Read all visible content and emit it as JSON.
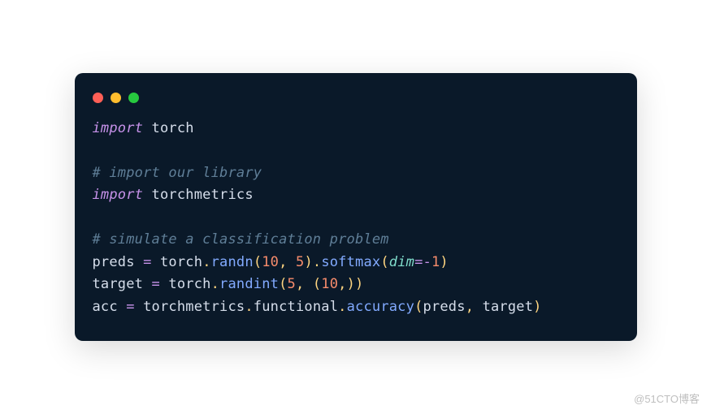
{
  "watermark": "@51CTO博客",
  "code": {
    "lines": [
      {
        "t": [
          {
            "c": "tok-keyword",
            "v": "import"
          },
          {
            "c": "",
            "v": " "
          },
          {
            "c": "tok-module",
            "v": "torch"
          }
        ]
      },
      {
        "t": []
      },
      {
        "t": [
          {
            "c": "tok-comment",
            "v": "# import our library"
          }
        ]
      },
      {
        "t": [
          {
            "c": "tok-keyword",
            "v": "import"
          },
          {
            "c": "",
            "v": " "
          },
          {
            "c": "tok-module",
            "v": "torchmetrics"
          }
        ]
      },
      {
        "t": []
      },
      {
        "t": [
          {
            "c": "tok-comment",
            "v": "# simulate a classification problem"
          }
        ]
      },
      {
        "t": [
          {
            "c": "tok-ident",
            "v": "preds"
          },
          {
            "c": "",
            "v": " "
          },
          {
            "c": "tok-op",
            "v": "="
          },
          {
            "c": "",
            "v": " "
          },
          {
            "c": "tok-ident",
            "v": "torch"
          },
          {
            "c": "tok-punct",
            "v": "."
          },
          {
            "c": "tok-func",
            "v": "randn"
          },
          {
            "c": "tok-punct",
            "v": "("
          },
          {
            "c": "tok-num",
            "v": "10"
          },
          {
            "c": "tok-punct",
            "v": ","
          },
          {
            "c": "",
            "v": " "
          },
          {
            "c": "tok-num",
            "v": "5"
          },
          {
            "c": "tok-punct",
            "v": ")."
          },
          {
            "c": "tok-func",
            "v": "softmax"
          },
          {
            "c": "tok-punct",
            "v": "("
          },
          {
            "c": "tok-param",
            "v": "dim"
          },
          {
            "c": "tok-op",
            "v": "=-"
          },
          {
            "c": "tok-num",
            "v": "1"
          },
          {
            "c": "tok-punct",
            "v": ")"
          }
        ]
      },
      {
        "t": [
          {
            "c": "tok-ident",
            "v": "target"
          },
          {
            "c": "",
            "v": " "
          },
          {
            "c": "tok-op",
            "v": "="
          },
          {
            "c": "",
            "v": " "
          },
          {
            "c": "tok-ident",
            "v": "torch"
          },
          {
            "c": "tok-punct",
            "v": "."
          },
          {
            "c": "tok-func",
            "v": "randint"
          },
          {
            "c": "tok-punct",
            "v": "("
          },
          {
            "c": "tok-num",
            "v": "5"
          },
          {
            "c": "tok-punct",
            "v": ","
          },
          {
            "c": "",
            "v": " "
          },
          {
            "c": "tok-punct",
            "v": "("
          },
          {
            "c": "tok-num",
            "v": "10"
          },
          {
            "c": "tok-punct",
            "v": ",))"
          }
        ]
      },
      {
        "t": [
          {
            "c": "tok-ident",
            "v": "acc"
          },
          {
            "c": "",
            "v": " "
          },
          {
            "c": "tok-op",
            "v": "="
          },
          {
            "c": "",
            "v": " "
          },
          {
            "c": "tok-ident",
            "v": "torchmetrics"
          },
          {
            "c": "tok-punct",
            "v": "."
          },
          {
            "c": "tok-ident",
            "v": "functional"
          },
          {
            "c": "tok-punct",
            "v": "."
          },
          {
            "c": "tok-func",
            "v": "accuracy"
          },
          {
            "c": "tok-punct",
            "v": "("
          },
          {
            "c": "tok-ident",
            "v": "preds"
          },
          {
            "c": "tok-punct",
            "v": ","
          },
          {
            "c": "",
            "v": " "
          },
          {
            "c": "tok-ident",
            "v": "target"
          },
          {
            "c": "tok-punct",
            "v": ")"
          }
        ]
      }
    ]
  }
}
